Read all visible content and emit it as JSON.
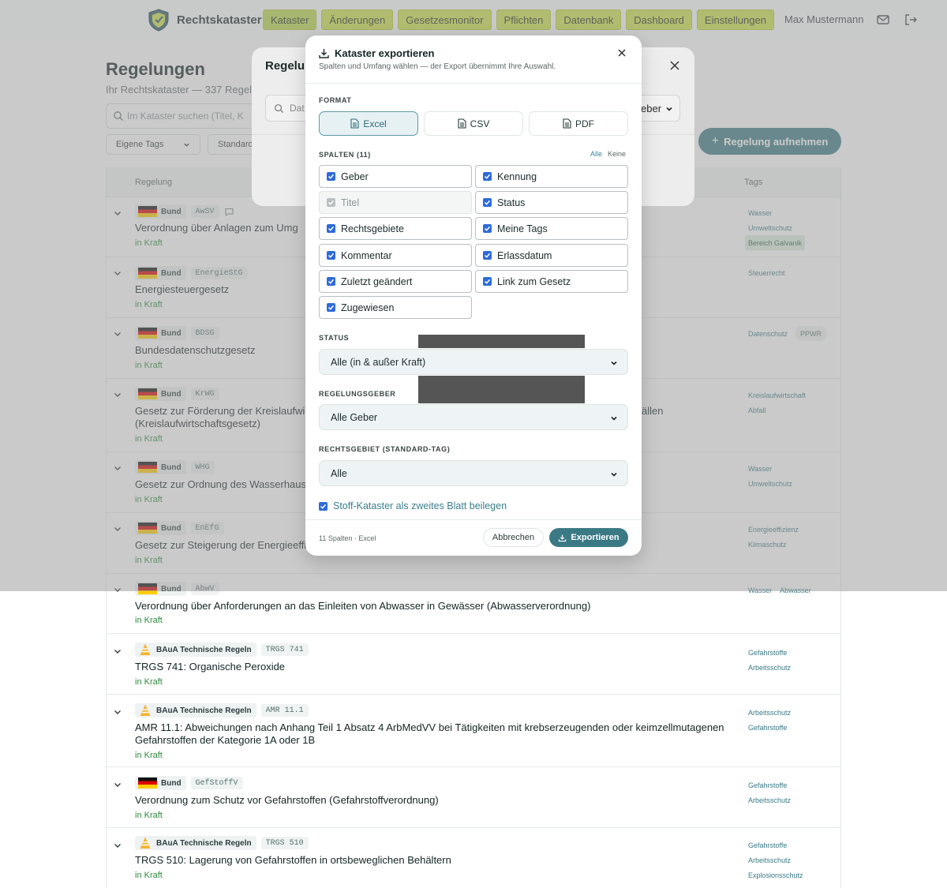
{
  "app": {
    "brand": "Rechtskataster",
    "nav": [
      "Kataster",
      "Änderungen",
      "Gesetzesmonitor",
      "Pflichten",
      "Datenbank",
      "Dashboard",
      "Einstellungen"
    ],
    "user": "Max Mustermann"
  },
  "page": {
    "title": "Regelungen",
    "subtitle": "Ihr Rechtskataster — 337 Regelun",
    "search_placeholder": "Im Kataster suchen (Titel, K",
    "filter1": "Eigene Tags",
    "filter2": "Standard",
    "add_button": "Regelung aufnehmen"
  },
  "table": {
    "headers": {
      "regelung": "Regelung",
      "tags": "Tags"
    },
    "rows": [
      {
        "giver": "Bund",
        "code": "AwSV",
        "title": "Verordnung über Anlagen zum Umg",
        "status": "in Kraft",
        "tags": [
          "Wasser",
          "Umweltschutz",
          "Bereich Galvanik"
        ]
      },
      {
        "giver": "Bund",
        "code": "EnergieStG",
        "title": "Energiesteuergesetz",
        "status": "in Kraft",
        "tags": [
          "Steuerrecht"
        ]
      },
      {
        "giver": "Bund",
        "code": "BDSG",
        "title": "Bundesdatenschutzgesetz",
        "status": "in Kraft",
        "tags": [
          "Datenschutz",
          "PPWR"
        ]
      },
      {
        "giver": "Bund",
        "code": "KrWG",
        "title": "Gesetz zur Förderung der Kreislaufwi",
        "title_tail": "ällen",
        "title2": "(Kreislaufwirtschaftsgesetz)",
        "status": "in Kraft",
        "tags": [
          "Kreislaufwirtschaft",
          "Abfall"
        ]
      },
      {
        "giver": "Bund",
        "code": "WHG",
        "title": "Gesetz zur Ordnung des Wasserhaus",
        "status": "in Kraft",
        "tags": [
          "Wasser",
          "Umweltschutz"
        ]
      },
      {
        "giver": "Bund",
        "code": "EnEfG",
        "title": "Gesetz zur Steigerung der Energieeffi",
        "status": "in Kraft",
        "tags": [
          "Energieeffizienz",
          "Klimaschutz"
        ]
      },
      {
        "giver": "Bund",
        "code": "AbwV",
        "title": "Verordnung über Anforderungen an das Einleiten von Abwasser in Gewässer (Abwasserverordnung)",
        "status": "in Kraft",
        "tags": [
          "Wasser",
          "Abwasser"
        ]
      },
      {
        "giver": "BAuA Technische Regeln",
        "code": "TRGS 741",
        "title": "TRGS 741: Organische Peroxide",
        "status": "in Kraft",
        "tags": [
          "Gefahrstoffe",
          "Arbeitsschutz"
        ]
      },
      {
        "giver": "BAuA Technische Regeln",
        "code": "AMR 11.1",
        "title": "AMR 11.1: Abweichungen nach Anhang Teil 1 Absatz 4 ArbMedVV bei Tätigkeiten mit krebserzeugenden oder keimzellmutagenen",
        "title2": "Gefahrstoffen der Kategorie 1A oder 1B",
        "status": "in Kraft",
        "tags": [
          "Arbeitsschutz",
          "Gefahrstoffe"
        ]
      },
      {
        "giver": "Bund",
        "code": "GefStoffV",
        "title": "Verordnung zum Schutz vor Gefahrstoffen (Gefahrstoffverordnung)",
        "status": "in Kraft",
        "tags": [
          "Gefahrstoffe",
          "Arbeitsschutz"
        ]
      },
      {
        "giver": "BAuA Technische Regeln",
        "code": "TRGS 510",
        "title": "TRGS 510: Lagerung von Gefahrstoffen in ortsbeweglichen Behältern",
        "status": "in Kraft",
        "tags": [
          "Gefahrstoffe",
          "Arbeitsschutz",
          "Explosionsschutz"
        ]
      }
    ]
  },
  "back_modal": {
    "title": "Regelur",
    "input_placeholder": "Dat",
    "select_value": "eber"
  },
  "export_modal": {
    "title": "Kataster exportieren",
    "subtitle": "Spalten und Umfang wählen — der Export übernimmt Ihre Auswahl.",
    "format_label": "FORMAT",
    "formats": [
      "Excel",
      "CSV",
      "PDF"
    ],
    "selected_format": "Excel",
    "columns_label": "SPALTEN (11)",
    "all": "Alle",
    "none": "Keine",
    "columns": [
      {
        "label": "Geber",
        "checked": true
      },
      {
        "label": "Kennung",
        "checked": true
      },
      {
        "label": "Titel",
        "checked": true,
        "disabled": true
      },
      {
        "label": "Status",
        "checked": true
      },
      {
        "label": "Rechtsgebiete",
        "checked": true
      },
      {
        "label": "Meine Tags",
        "checked": true
      },
      {
        "label": "Kommentar",
        "checked": true
      },
      {
        "label": "Erlassdatum",
        "checked": true
      },
      {
        "label": "Zuletzt geändert",
        "checked": true
      },
      {
        "label": "Link zum Gesetz",
        "checked": true
      },
      {
        "label": "Zugewiesen",
        "checked": true
      }
    ],
    "status_label": "STATUS",
    "status_value": "Alle (in & außer Kraft)",
    "geber_label": "REGELUNGSGEBER",
    "geber_value": "Alle Geber",
    "rg_label": "RECHTSGEBIET (STANDARD-TAG)",
    "rg_value": "Alle",
    "stoff_label": "Stoff-Kataster als zweites Blatt beilegen",
    "stoff_checked": true,
    "footer_info": "11 Spalten · Excel",
    "cancel": "Abbrechen",
    "export": "Exportieren"
  },
  "colors": {
    "accent": "#3b7a85",
    "nav": "#cfe34a",
    "status_green": "#2f8a3d",
    "checkbox": "#2d6bd8"
  }
}
